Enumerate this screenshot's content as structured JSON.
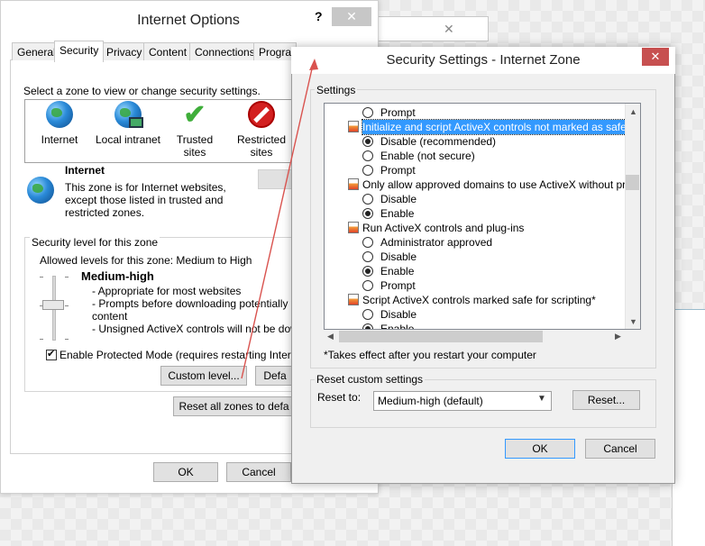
{
  "internet_options": {
    "title": "Internet Options",
    "help": "?",
    "close": "✕",
    "tabs": [
      "General",
      "Security",
      "Privacy",
      "Content",
      "Connections",
      "Program"
    ],
    "zone_prompt": "Select a zone to view or change security settings.",
    "zones": [
      {
        "label": "Internet",
        "icon": "globe-icon"
      },
      {
        "label": "Local intranet",
        "icon": "intranet-icon"
      },
      {
        "label": "Trusted sites",
        "icon": "checkmark-icon"
      },
      {
        "label": "Restricted sites",
        "icon": "no-entry-icon"
      }
    ],
    "zone_info": {
      "name": "Internet",
      "description": "This zone is for Internet websites, except those listed in trusted and restricted zones."
    },
    "security_level": {
      "legend": "Security level for this zone",
      "allowed": "Allowed levels for this zone: Medium to High",
      "level_name": "Medium-high",
      "details": [
        "- Appropriate for most websites",
        "- Prompts before downloading potentially unsa",
        "content",
        "- Unsigned ActiveX controls will not be downloa"
      ]
    },
    "protected_mode": {
      "label": "Enable Protected Mode (requires restarting Internet E",
      "checked": true
    },
    "custom_level_label": "Custom level...",
    "default_level_label": "Defa",
    "reset_all_label": "Reset all zones to defa",
    "ok_label": "OK",
    "cancel_label": "Cancel"
  },
  "bg_close": "✕",
  "security_settings": {
    "title": "Security Settings - Internet Zone",
    "close": "✕",
    "settings_legend": "Settings",
    "rows": [
      {
        "type": "option",
        "text": "Prompt",
        "checked": false
      },
      {
        "type": "setting",
        "text": "Initialize and script ActiveX controls not marked as safe for sc",
        "selected": true
      },
      {
        "type": "option",
        "text": "Disable (recommended)",
        "checked": true
      },
      {
        "type": "option",
        "text": "Enable (not secure)",
        "checked": false
      },
      {
        "type": "option",
        "text": "Prompt",
        "checked": false
      },
      {
        "type": "setting",
        "text": "Only allow approved domains to use ActiveX without prompt",
        "selected": false
      },
      {
        "type": "option",
        "text": "Disable",
        "checked": false
      },
      {
        "type": "option",
        "text": "Enable",
        "checked": true
      },
      {
        "type": "setting",
        "text": "Run ActiveX controls and plug-ins",
        "selected": false
      },
      {
        "type": "option",
        "text": "Administrator approved",
        "checked": false
      },
      {
        "type": "option",
        "text": "Disable",
        "checked": false
      },
      {
        "type": "option",
        "text": "Enable",
        "checked": true
      },
      {
        "type": "option",
        "text": "Prompt",
        "checked": false
      },
      {
        "type": "setting",
        "text": "Script ActiveX controls marked safe for scripting*",
        "selected": false
      },
      {
        "type": "option",
        "text": "Disable",
        "checked": false
      },
      {
        "type": "option",
        "text": "Enable",
        "checked": true
      }
    ],
    "takes_effect": "*Takes effect after you restart your computer",
    "reset_legend": "Reset custom settings",
    "reset_to_label": "Reset to:",
    "reset_to_value": "Medium-high (default)",
    "reset_button": "Reset...",
    "ok_label": "OK",
    "cancel_label": "Cancel"
  }
}
